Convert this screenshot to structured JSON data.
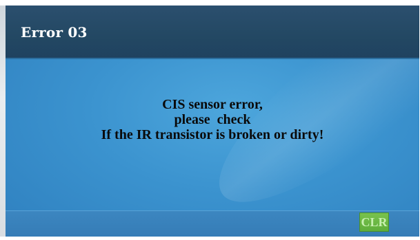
{
  "dialog": {
    "title": "Error 03",
    "message_lines": [
      "CIS sensor error,",
      "please  check",
      "If the IR transistor is broken or dirty!"
    ]
  },
  "footer": {
    "clear_button_label": "CLR"
  },
  "colors": {
    "title_bar": "#234863",
    "screen_background": "#3b93cf",
    "footer_bar": "#357cb6",
    "clear_button": "#6bb846",
    "message_text": "#0a0a0a",
    "title_text": "#ffffff"
  }
}
